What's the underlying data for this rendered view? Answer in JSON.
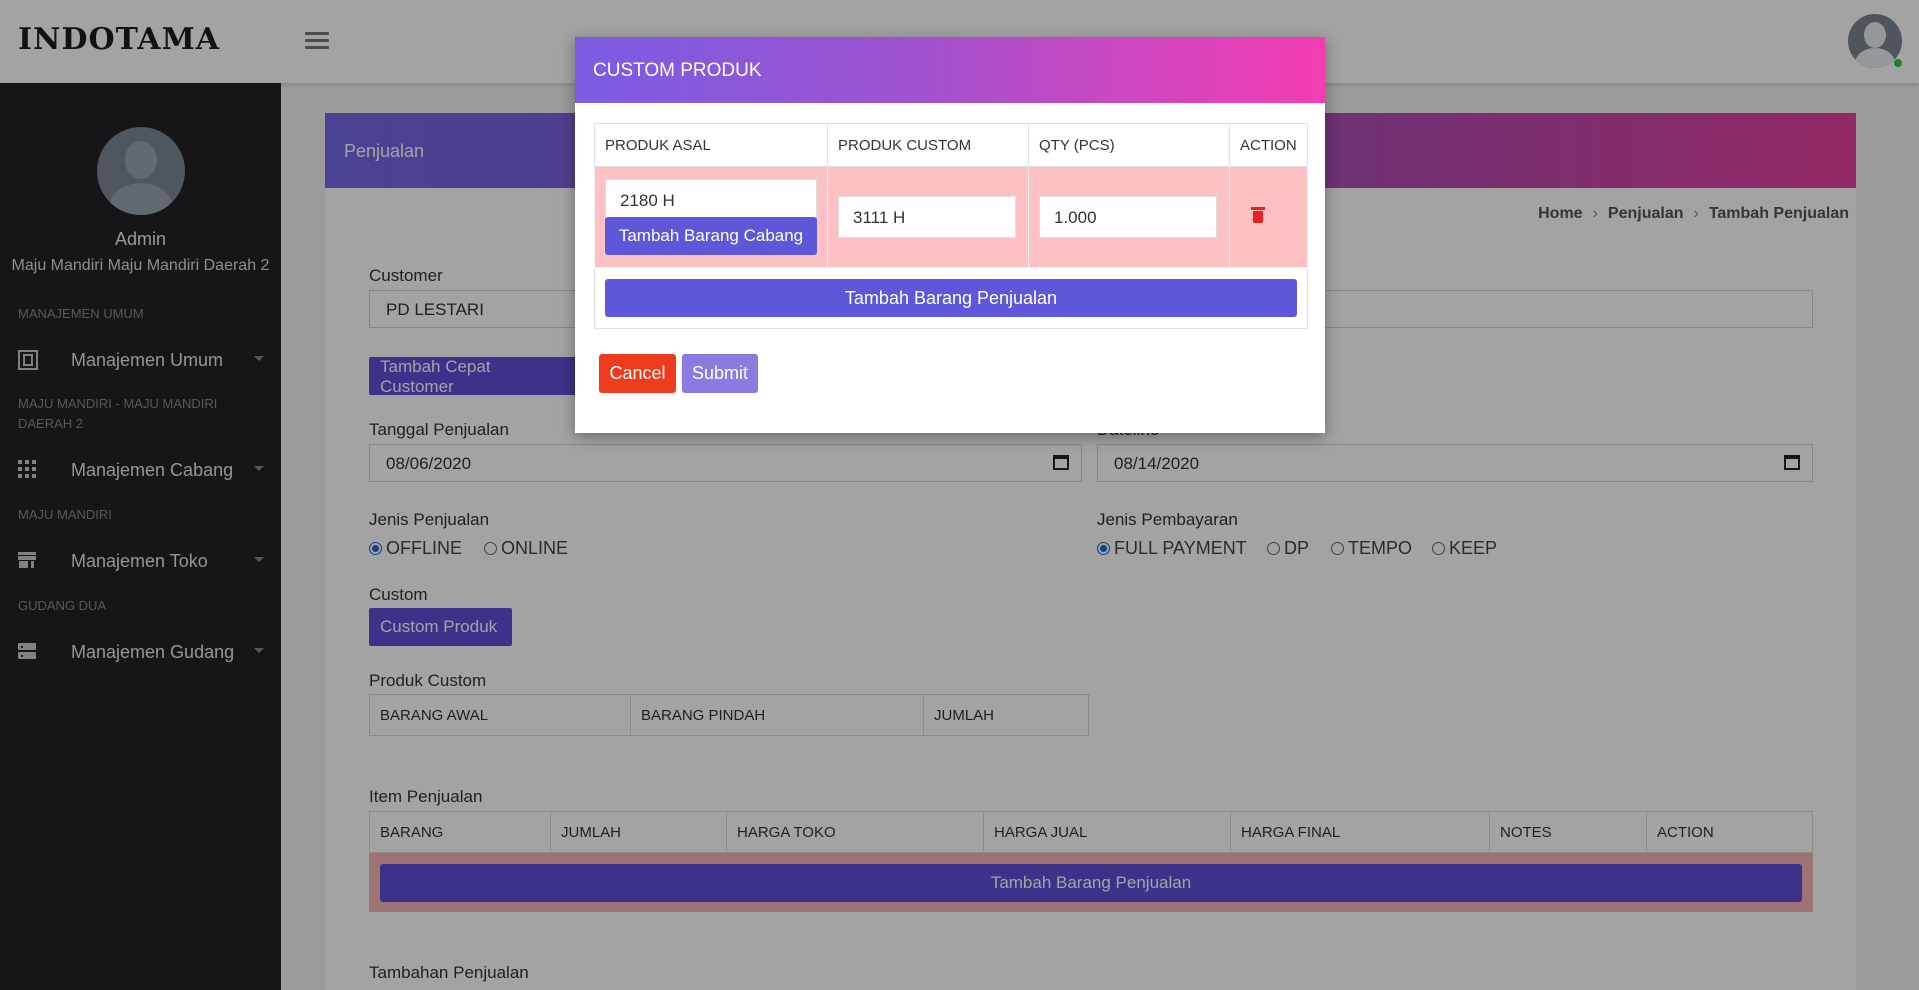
{
  "header": {
    "brand": "INDOTAMA",
    "menu_icon": "hamburger-icon",
    "avatar_icon": "user-avatar-icon"
  },
  "sidebar": {
    "user_name": "Admin",
    "branch_name": "Maju Mandiri Maju Mandiri Daerah 2",
    "sections": [
      {
        "title": "MANAJEMEN UMUM",
        "item": {
          "label": "Manajemen Umum",
          "icon": "building-icon"
        }
      },
      {
        "title": "MAJU MANDIRI - MAJU MANDIRI DAERAH 2",
        "item": {
          "label": "Manajemen Cabang",
          "icon": "grid-icon"
        }
      },
      {
        "title": "MAJU MANDIRI",
        "item": {
          "label": "Manajemen Toko",
          "icon": "store-icon"
        }
      },
      {
        "title": "GUDANG DUA",
        "item": {
          "label": "Manajemen Gudang",
          "icon": "server-icon"
        }
      }
    ]
  },
  "page": {
    "title": "Penjualan",
    "breadcrumb": [
      "Home",
      "Penjualan",
      "Tambah Penjualan"
    ],
    "customer_label": "Customer",
    "customer_value": "PD LESTARI",
    "quick_customer_button": "Tambah Cepat Customer",
    "tanggal_label": "Tanggal Penjualan",
    "tanggal_value": "08/06/2020",
    "deadline_label": "Dateline",
    "deadline_value": "08/14/2020",
    "jenis_penjualan_label": "Jenis Penjualan",
    "jenis_penjualan_options": [
      {
        "label": "OFFLINE",
        "selected": true
      },
      {
        "label": "ONLINE",
        "selected": false
      }
    ],
    "jenis_pembayaran_label": "Jenis Pembayaran",
    "jenis_pembayaran_options": [
      {
        "label": "FULL PAYMENT",
        "selected": true
      },
      {
        "label": "DP",
        "selected": false
      },
      {
        "label": "TEMPO",
        "selected": false
      },
      {
        "label": "KEEP",
        "selected": false
      }
    ],
    "custom_label": "Custom",
    "custom_button": "Custom Produk",
    "produk_custom_label": "Produk Custom",
    "produk_custom_columns": [
      "BARANG AWAL",
      "BARANG PINDAH",
      "JUMLAH"
    ],
    "item_penjualan_label": "Item Penjualan",
    "item_penjualan_columns": [
      "BARANG",
      "JUMLAH",
      "HARGA TOKO",
      "HARGA JUAL",
      "HARGA FINAL",
      "NOTES",
      "ACTION"
    ],
    "add_item_button": "Tambah Barang Penjualan",
    "tambahan_label": "Tambahan Penjualan"
  },
  "modal": {
    "title": "CUSTOM PRODUK",
    "columns": [
      "PRODUK ASAL",
      "PRODUK CUSTOM",
      "QTY (PCS)",
      "ACTION"
    ],
    "row": {
      "produk_asal": "2180 H",
      "tambah_cabang_button": "Tambah Barang Cabang",
      "produk_custom": "3111 H",
      "qty": "1.000",
      "delete_icon": "trash-icon"
    },
    "add_button": "Tambah Barang Penjualan",
    "cancel_button": "Cancel",
    "submit_button": "Submit"
  },
  "colors": {
    "brand_purple": "#5e4fd6",
    "cancel_red": "#ee3a1d",
    "row_pink": "#fec1c3",
    "sidebar_bg": "#232326"
  }
}
